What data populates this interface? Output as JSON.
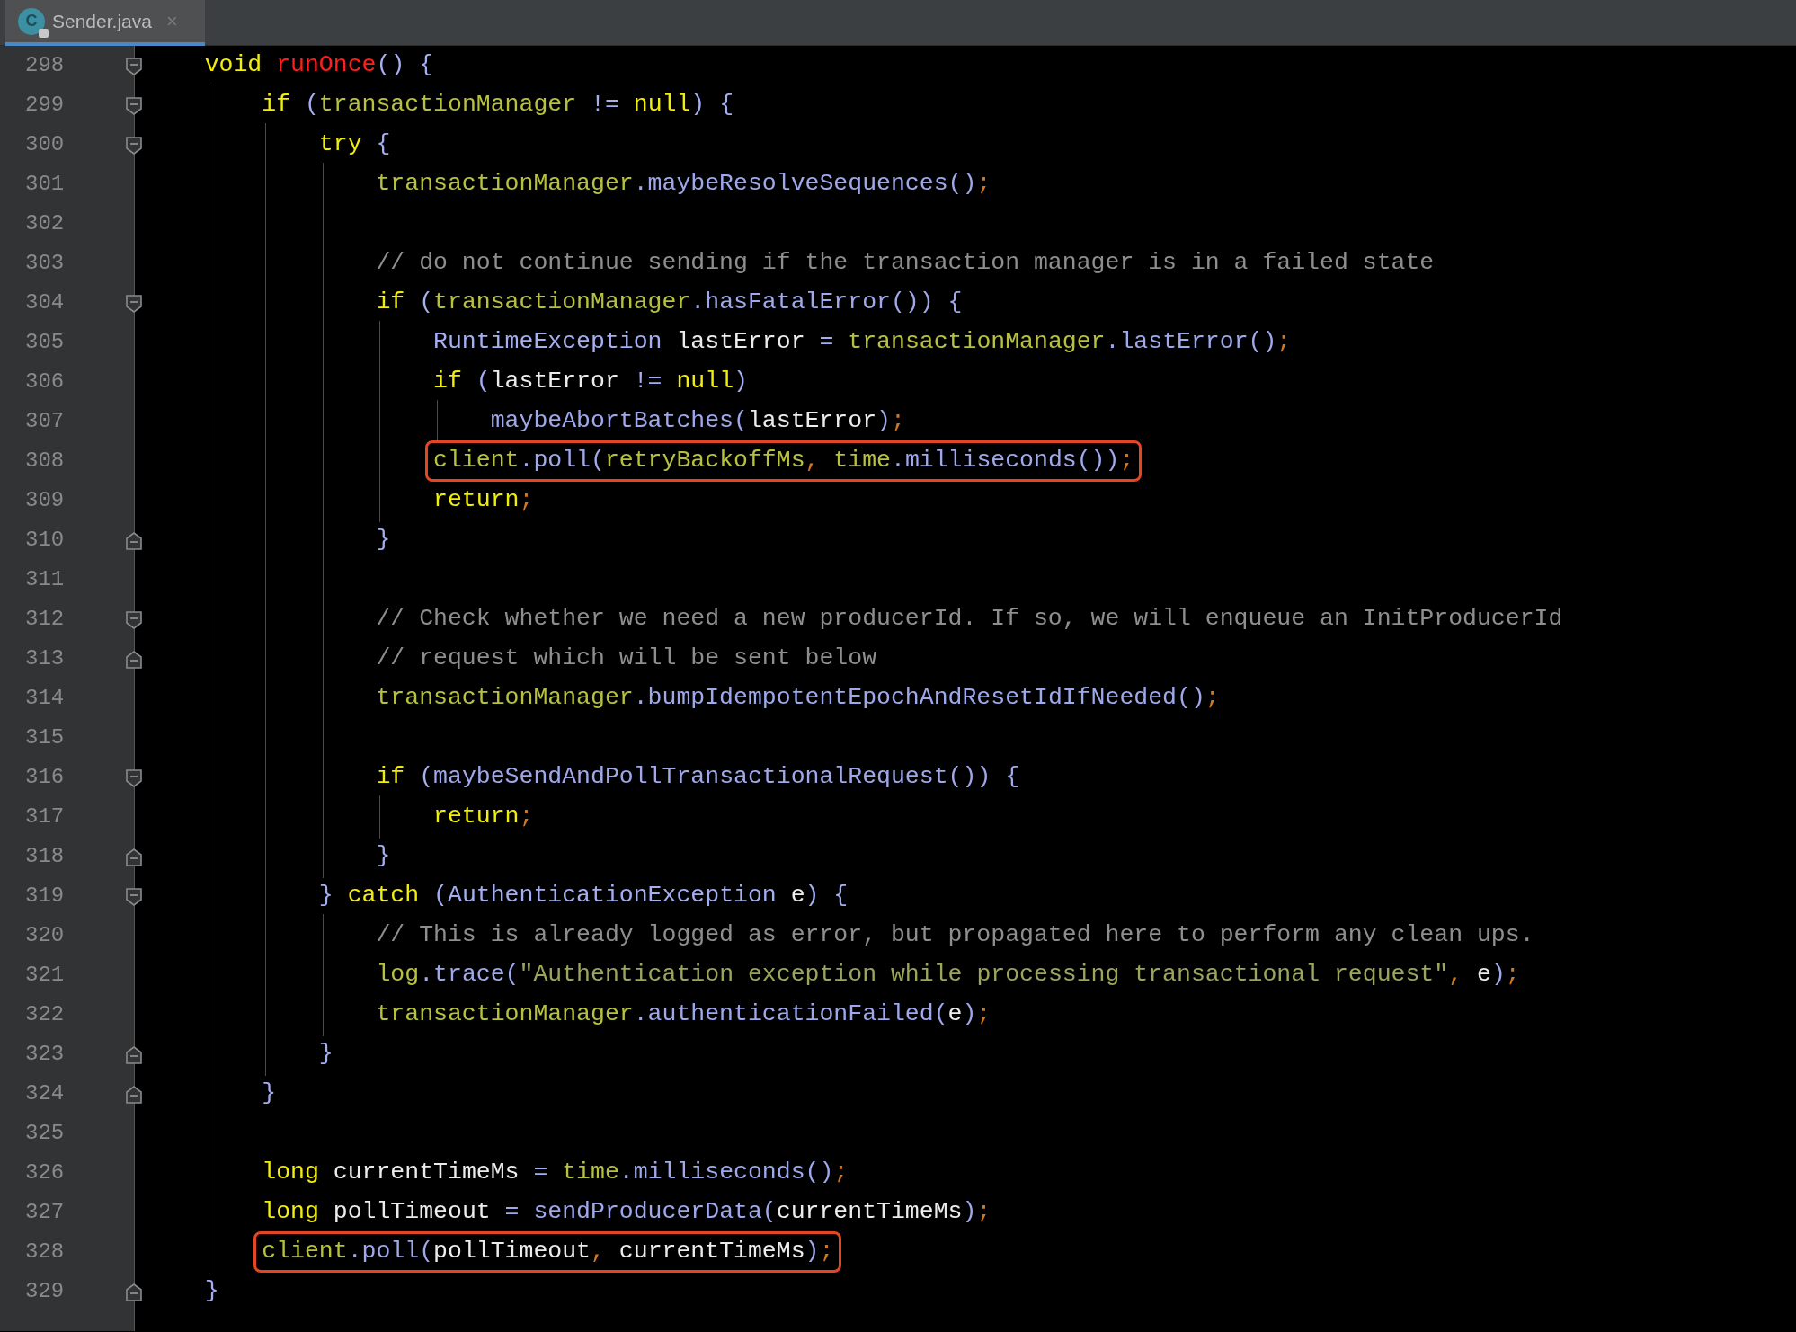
{
  "tabs": [
    {
      "label": "Sender.java",
      "icon_letter": "C",
      "close": "×",
      "selected": true
    }
  ],
  "lines": [
    {
      "number": "298",
      "fold": {
        "kind": "open"
      },
      "tokens": [
        {
          "text": "    void",
          "kind": "keyword"
        },
        {
          "text": " runOnce",
          "kind": "declaration"
        },
        {
          "text": "() {",
          "kind": "punct"
        }
      ]
    },
    {
      "number": "299",
      "fold": {
        "kind": "open"
      },
      "tokens": [
        {
          "text": "        if",
          "kind": "keyword"
        },
        {
          "text": " (",
          "kind": "punct"
        },
        {
          "text": "transactionManager",
          "kind": "field"
        },
        {
          "text": " != ",
          "kind": "punct"
        },
        {
          "text": "null",
          "kind": "keyword"
        },
        {
          "text": ") {",
          "kind": "punct"
        }
      ]
    },
    {
      "number": "300",
      "fold": {
        "kind": "open"
      },
      "tokens": [
        {
          "text": "            try",
          "kind": "keyword"
        },
        {
          "text": " {",
          "kind": "punct"
        }
      ]
    },
    {
      "number": "301",
      "tokens": [
        {
          "text": "                transactionManager",
          "kind": "field"
        },
        {
          "text": ".maybeResolveSequences()",
          "kind": "method"
        },
        {
          "text": ";",
          "kind": "sep"
        }
      ]
    },
    {
      "number": "302"
    },
    {
      "number": "303",
      "tokens": [
        {
          "text": "                // do not continue sending if the transaction manager is in a failed state",
          "kind": "comment"
        }
      ]
    },
    {
      "number": "304",
      "fold": {
        "kind": "open"
      },
      "tokens": [
        {
          "text": "                if",
          "kind": "keyword"
        },
        {
          "text": " (",
          "kind": "punct"
        },
        {
          "text": "transactionManager",
          "kind": "field"
        },
        {
          "text": ".hasFatalError()) {",
          "kind": "method"
        }
      ]
    },
    {
      "number": "305",
      "tokens": [
        {
          "text": "                    RuntimeException",
          "kind": "type"
        },
        {
          "text": " lastError ",
          "kind": "local"
        },
        {
          "text": "= ",
          "kind": "punct"
        },
        {
          "text": "transactionManager",
          "kind": "field"
        },
        {
          "text": ".lastError()",
          "kind": "method"
        },
        {
          "text": ";",
          "kind": "sep"
        }
      ]
    },
    {
      "number": "306",
      "tokens": [
        {
          "text": "                    if",
          "kind": "keyword"
        },
        {
          "text": " (",
          "kind": "punct"
        },
        {
          "text": "lastError",
          "kind": "local"
        },
        {
          "text": " != ",
          "kind": "punct"
        },
        {
          "text": "null",
          "kind": "keyword"
        },
        {
          "text": ")",
          "kind": "punct"
        }
      ]
    },
    {
      "number": "307",
      "tokens": [
        {
          "text": "                        maybeAbortBatches(",
          "kind": "method"
        },
        {
          "text": "lastError",
          "kind": "local"
        },
        {
          "text": ")",
          "kind": "method"
        },
        {
          "text": ";",
          "kind": "sep"
        }
      ]
    },
    {
      "number": "308",
      "highlighted": true,
      "tokens": [
        {
          "text": "                    client",
          "kind": "field"
        },
        {
          "text": ".poll(",
          "kind": "method"
        },
        {
          "text": "retryBackoffMs",
          "kind": "field"
        },
        {
          "text": ", ",
          "kind": "sep"
        },
        {
          "text": "time",
          "kind": "field"
        },
        {
          "text": ".milliseconds())",
          "kind": "method"
        },
        {
          "text": ";",
          "kind": "sep"
        }
      ]
    },
    {
      "number": "309",
      "tokens": [
        {
          "text": "                    return",
          "kind": "keyword"
        },
        {
          "text": ";",
          "kind": "sep"
        }
      ]
    },
    {
      "number": "310",
      "fold": {
        "kind": "close"
      },
      "tokens": [
        {
          "text": "                }",
          "kind": "punct"
        }
      ]
    },
    {
      "number": "311"
    },
    {
      "number": "312",
      "fold": {
        "kind": "open"
      },
      "tokens": [
        {
          "text": "                // Check whether we need a new producerId. If so, we will enqueue an InitProducerId",
          "kind": "comment"
        }
      ]
    },
    {
      "number": "313",
      "fold": {
        "kind": "close"
      },
      "tokens": [
        {
          "text": "                // request which will be sent below",
          "kind": "comment"
        }
      ]
    },
    {
      "number": "314",
      "tokens": [
        {
          "text": "                transactionManager",
          "kind": "field"
        },
        {
          "text": ".bumpIdempotentEpochAndResetIdIfNeeded()",
          "kind": "method"
        },
        {
          "text": ";",
          "kind": "sep"
        }
      ]
    },
    {
      "number": "315"
    },
    {
      "number": "316",
      "fold": {
        "kind": "open"
      },
      "tokens": [
        {
          "text": "                if",
          "kind": "keyword"
        },
        {
          "text": " (",
          "kind": "punct"
        },
        {
          "text": "maybeSendAndPollTransactionalRequest()) {",
          "kind": "method"
        }
      ]
    },
    {
      "number": "317",
      "tokens": [
        {
          "text": "                    return",
          "kind": "keyword"
        },
        {
          "text": ";",
          "kind": "sep"
        }
      ]
    },
    {
      "number": "318",
      "fold": {
        "kind": "close"
      },
      "tokens": [
        {
          "text": "                }",
          "kind": "punct"
        }
      ]
    },
    {
      "number": "319",
      "fold": {
        "kind": "open"
      },
      "tokens": [
        {
          "text": "            } ",
          "kind": "punct"
        },
        {
          "text": "catch",
          "kind": "keyword"
        },
        {
          "text": " (AuthenticationException ",
          "kind": "punct"
        },
        {
          "text": "e",
          "kind": "local"
        },
        {
          "text": ") {",
          "kind": "punct"
        }
      ]
    },
    {
      "number": "320",
      "tokens": [
        {
          "text": "                // This is already logged as error, but propagated here to perform any clean ups.",
          "kind": "comment"
        }
      ]
    },
    {
      "number": "321",
      "tokens": [
        {
          "text": "                log",
          "kind": "field"
        },
        {
          "text": ".trace(",
          "kind": "method"
        },
        {
          "text": "\"Authentication exception while processing transactional request\"",
          "kind": "string"
        },
        {
          "text": ", ",
          "kind": "sep"
        },
        {
          "text": "e",
          "kind": "local"
        },
        {
          "text": ")",
          "kind": "method"
        },
        {
          "text": ";",
          "kind": "sep"
        }
      ]
    },
    {
      "number": "322",
      "tokens": [
        {
          "text": "                transactionManager",
          "kind": "field"
        },
        {
          "text": ".authenticationFailed(",
          "kind": "method"
        },
        {
          "text": "e",
          "kind": "local"
        },
        {
          "text": ")",
          "kind": "method"
        },
        {
          "text": ";",
          "kind": "sep"
        }
      ]
    },
    {
      "number": "323",
      "fold": {
        "kind": "close"
      },
      "tokens": [
        {
          "text": "            }",
          "kind": "punct"
        }
      ]
    },
    {
      "number": "324",
      "fold": {
        "kind": "close"
      },
      "tokens": [
        {
          "text": "        }",
          "kind": "punct"
        }
      ]
    },
    {
      "number": "325"
    },
    {
      "number": "326",
      "tokens": [
        {
          "text": "        long",
          "kind": "keyword"
        },
        {
          "text": " currentTimeMs ",
          "kind": "local"
        },
        {
          "text": "= ",
          "kind": "punct"
        },
        {
          "text": "time",
          "kind": "field"
        },
        {
          "text": ".milliseconds()",
          "kind": "method"
        },
        {
          "text": ";",
          "kind": "sep"
        }
      ]
    },
    {
      "number": "327",
      "tokens": [
        {
          "text": "        long",
          "kind": "keyword"
        },
        {
          "text": " pollTimeout ",
          "kind": "local"
        },
        {
          "text": "= sendProducerData(",
          "kind": "method"
        },
        {
          "text": "currentTimeMs",
          "kind": "local"
        },
        {
          "text": ")",
          "kind": "method"
        },
        {
          "text": ";",
          "kind": "sep"
        }
      ]
    },
    {
      "number": "328",
      "highlighted": true,
      "tokens": [
        {
          "text": "        client",
          "kind": "field"
        },
        {
          "text": ".poll(",
          "kind": "method"
        },
        {
          "text": "pollTimeout",
          "kind": "local"
        },
        {
          "text": ", ",
          "kind": "sep"
        },
        {
          "text": "currentTimeMs",
          "kind": "local"
        },
        {
          "text": ")",
          "kind": "method"
        },
        {
          "text": ";",
          "kind": "sep"
        }
      ]
    },
    {
      "number": "329",
      "fold": {
        "kind": "close"
      },
      "tokens": [
        {
          "text": "    }",
          "kind": "punct"
        }
      ]
    }
  ]
}
